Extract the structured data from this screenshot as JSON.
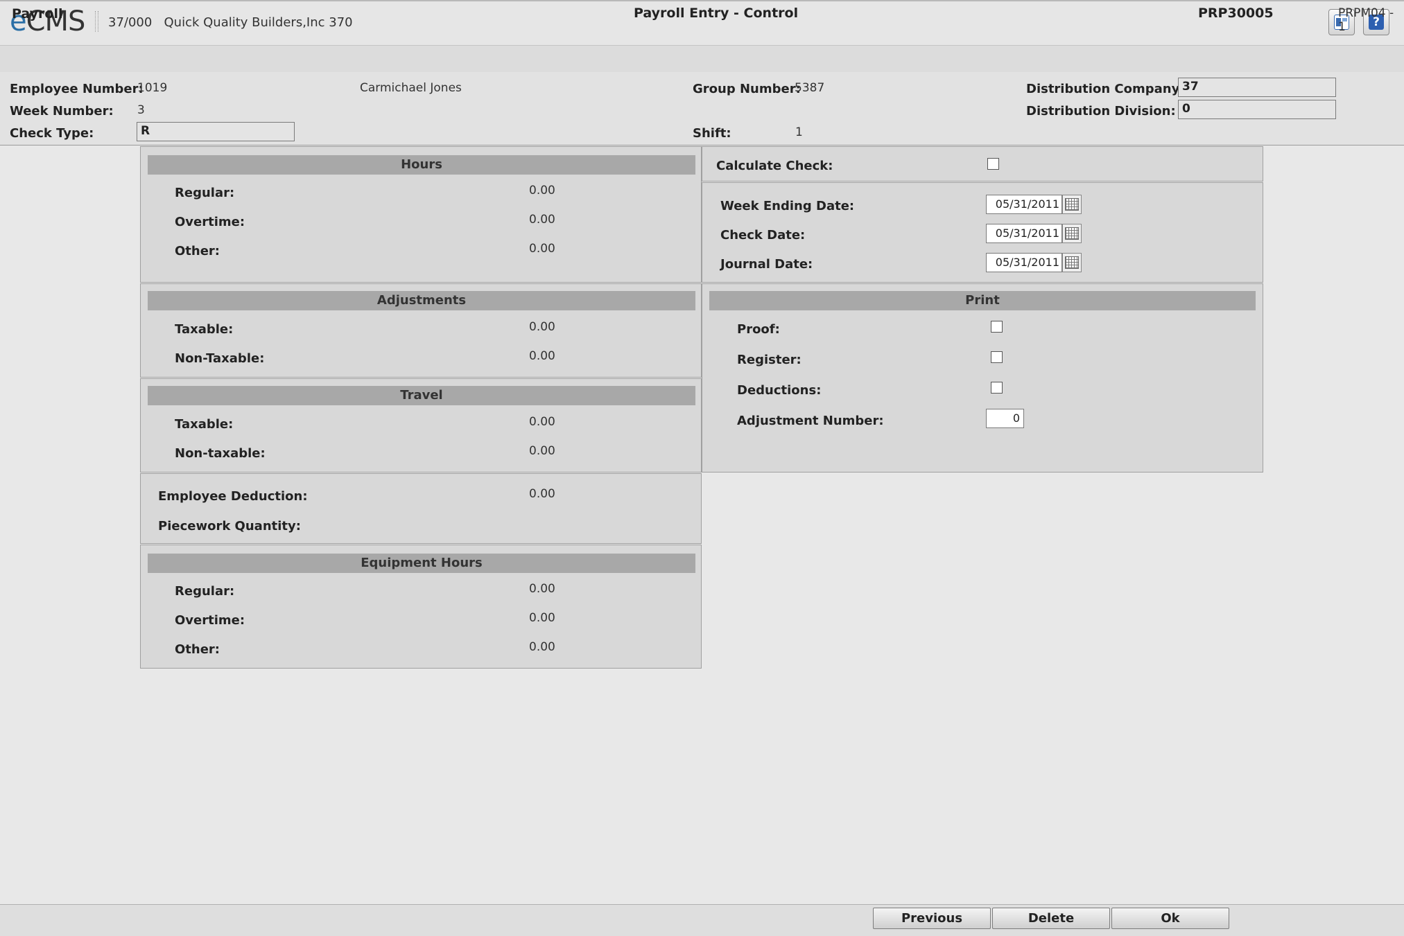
{
  "app": {
    "logo_e": "e",
    "logo_rest": "CMS",
    "company_code": "37/000",
    "company_name": "Quick Quality Builders,Inc 370",
    "help_label": "?"
  },
  "titlebar": {
    "module": "Payroll",
    "title": "Payroll Entry - Control",
    "program": "PRP30005",
    "screen": "PRPM04 - 1"
  },
  "header": {
    "employee_number_label": "Employee Number:",
    "employee_number": "1019",
    "employee_name": "Carmichael Jones",
    "week_number_label": "Week Number:",
    "week_number": "3",
    "check_type_label": "Check Type:",
    "check_type": "R",
    "group_number_label": "Group Number:",
    "group_number": "5387",
    "shift_label": "Shift:",
    "shift": "1",
    "dist_company_label": "Distribution Company:",
    "dist_company": "37",
    "dist_division_label": "Distribution Division:",
    "dist_division": "0"
  },
  "hours": {
    "title": "Hours",
    "regular_label": "Regular:",
    "regular": "0.00",
    "overtime_label": "Overtime:",
    "overtime": "0.00",
    "other_label": "Other:",
    "other": "0.00"
  },
  "adjustments": {
    "title": "Adjustments",
    "taxable_label": "Taxable:",
    "taxable": "0.00",
    "nontaxable_label": "Non-Taxable:",
    "nontaxable": "0.00"
  },
  "travel": {
    "title": "Travel",
    "taxable_label": "Taxable:",
    "taxable": "0.00",
    "nontaxable_label": "Non-taxable:",
    "nontaxable": "0.00"
  },
  "misc": {
    "employee_deduction_label": "Employee Deduction:",
    "employee_deduction": "0.00",
    "piecework_label": "Piecework Quantity:"
  },
  "equipment": {
    "title": "Equipment Hours",
    "regular_label": "Regular:",
    "regular": "0.00",
    "overtime_label": "Overtime:",
    "overtime": "0.00",
    "other_label": "Other:",
    "other": "0.00"
  },
  "calc": {
    "calculate_check_label": "Calculate Check:",
    "calculate_check": false
  },
  "dates": {
    "week_ending_label": "Week Ending Date:",
    "week_ending": "05/31/2011",
    "check_date_label": "Check Date:",
    "check_date": "05/31/2011",
    "journal_date_label": "Journal Date:",
    "journal_date": "05/31/2011"
  },
  "print": {
    "title": "Print",
    "proof_label": "Proof:",
    "proof": false,
    "register_label": "Register:",
    "register": false,
    "deductions_label": "Deductions:",
    "deductions": false,
    "adjustment_number_label": "Adjustment Number:",
    "adjustment_number": "0"
  },
  "footer": {
    "previous": "Previous",
    "delete": "Delete",
    "ok": "Ok"
  }
}
